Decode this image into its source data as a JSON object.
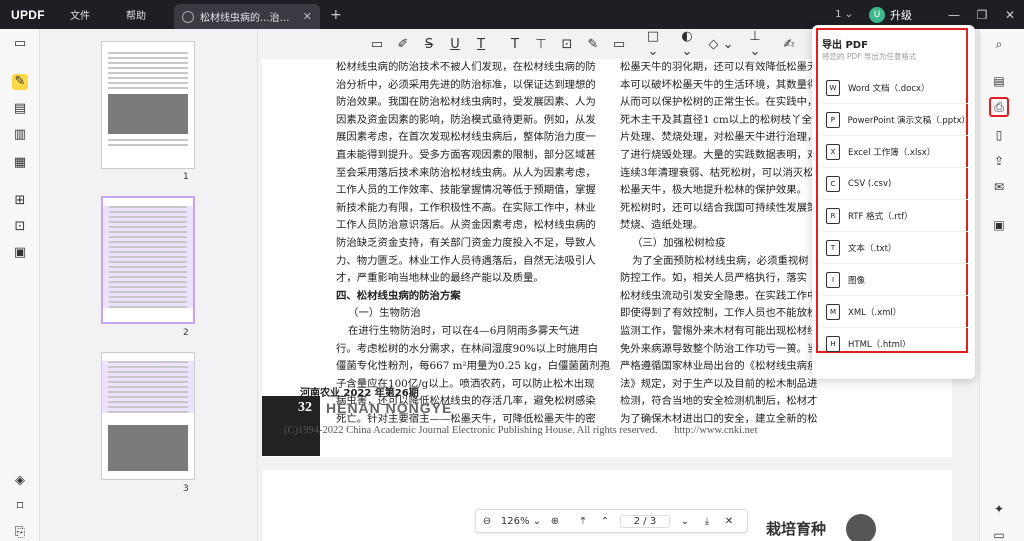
{
  "titlebar": {
    "logo": "UPDF",
    "menus": [
      "文件",
      "帮助"
    ],
    "tab_title": "松材线虫病的...治对策_田勇",
    "version": "1",
    "upgrade_label": "升级",
    "avatar_letter": "U"
  },
  "thumbnails": {
    "pages": [
      "1",
      "2",
      "3"
    ]
  },
  "document": {
    "col1": [
      "松材线虫病的防治技术不被人们发现，在松材线虫病的防",
      "治分析中，必须采用先进的防治标准，以保证达到理想的",
      "防治效果。我国在防治松材线虫病时，受发展因素、人为",
      "因素及资金因素的影响，防治模式亟待更新。例如，从发",
      "展因素考虑，在首次发现松材线虫病后，整体防治力度一",
      "直未能得到提升。受多方面客观因素的限制，部分区域甚",
      "至会采用落后技术来防治松材线虫病。从人为因素考虑，",
      "工作人员的工作效率、技能掌握情况等低于预期值，掌握",
      "新技术能力有限，工作积极性不高。在实际工作中，林业",
      "工作人员防治意识落后。从资金因素考虑，松材线虫病的",
      "防治缺乏资金支持，有关部门资金力度投入不足，导致人",
      "力、物力匮乏。林业工作人员待遇落后，自然无法吸引人",
      "才，严重影响当地林业的最终产能以及质量。"
    ],
    "heading": "四、松材线虫病的防治方案",
    "subheading": "（一）生物防治",
    "col1b": [
      "在进行生物防治时，可以在4—6月阴雨多雾天气进",
      "行。考虑松树的水分需求，在林间湿度90%以上时施用白",
      "僵菌专化性粉剂，每667 m²用量为0.25 kg，白僵菌菌剂孢",
      "子含量应在100亿/g以上。喷洒农药，可以防止松木出现",
      "病虫害，还可以降低松材线虫的存活几率，避免松树感染",
      "死亡。针对主要宿主——松墨天牛，可降低松墨天牛的密"
    ],
    "col2": [
      "松墨天牛的羽化期，还可以有效降低松墨天牛的密度",
      "本可以破坏松墨天牛的生活环境，其数量得",
      "从而可以保护松树的正常生长。在实践中，",
      "死木主干及其直径1 cm以上的松树枝丫全",
      "片处理、焚烧处理，对松墨天牛进行治理，",
      "了进行烧毁处理。大量的实践数据表明，对",
      "连续3年清理衰弱、枯死松树，可以消灭松",
      "松墨天牛，极大地提升松林的保护效果。",
      "死松树时，还可以结合我国可持续性发展策",
      "焚烧、造纸处理。"
    ],
    "col2_heading": "（三）加强松树检疫",
    "col2b": [
      "为了全面预防松材线虫病，必须重视树",
      "防控工作。如，相关人员严格执行，落实",
      "松材线虫流动引发安全隐患。在实践工作中",
      "即使得到了有效控制，工作人员也不能放松",
      "监测工作，警惕外来木材有可能出现松材线",
      "免外来病源导致整个防治工作功亏一篑。当",
      "严格遵循国家林业局出台的《松材线虫病疫区",
      "法》规定，对于生产以及目前的松木制品进",
      "检测，符合当地的安全检测机制后，松材才",
      "为了确保木材进出口的安全，建立全新的松"
    ],
    "footer_journal": "河南农业 2022 年第26期",
    "footer_num": "32",
    "footer_name": "HENAN   NONGYE",
    "footer_copy": "(C)1994-2022 China Academic Journal Electronic Publishing House. All rights reserved.",
    "footer_url": "http://www.cnki.net",
    "page2_logo": "栽培育种"
  },
  "pagenav": {
    "zoom": "126%",
    "page_indicator": "2 / 3"
  },
  "export": {
    "title": "导出 PDF",
    "subtitle": "将您的 PDF 导出为任意格式",
    "options": [
      {
        "label": "Word 文档（.docx）",
        "icon": "W"
      },
      {
        "label": "PowerPoint 演示文稿（.pptx）",
        "icon": "P"
      },
      {
        "label": "Excel 工作簿（.xlsx）",
        "icon": "X"
      },
      {
        "label": "CSV (.csv)",
        "icon": "C"
      },
      {
        "label": "RTF 格式（.rtf）",
        "icon": "R"
      },
      {
        "label": "文本（.txt）",
        "icon": "T"
      },
      {
        "label": "图像",
        "icon": "I"
      },
      {
        "label": "XML（.xml）",
        "icon": "M"
      },
      {
        "label": "HTML（.html）",
        "icon": "H"
      }
    ]
  },
  "colors": {
    "accent_red": "#e02020",
    "highlight_yellow": "#ffd84a",
    "titlebar": "#1e1f24",
    "selection_purple": "#c9a3f2"
  }
}
